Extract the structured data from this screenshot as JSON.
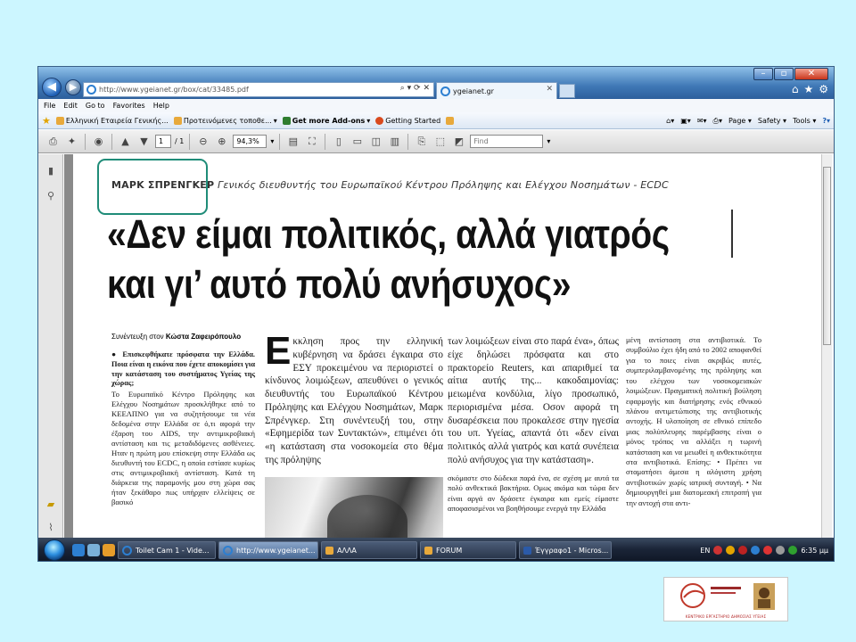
{
  "browser": {
    "address_url": "http://www.ygeianet.gr/box/cat/33485.pdf",
    "tab_title": "ygeianet.gr",
    "menu": [
      "File",
      "Edit",
      "Go to",
      "Favorites",
      "Help"
    ],
    "favorites": [
      {
        "label": "Ελληνική Εταιρεία Γενικής..."
      },
      {
        "label": "Προτεινόμενες τοποθε..."
      },
      {
        "label": "Get more Add-ons"
      },
      {
        "label": "Getting Started"
      }
    ],
    "command_bar": [
      "Page",
      "Safety",
      "Tools"
    ]
  },
  "pdf_toolbar": {
    "page_current": "1",
    "page_total": "/ 1",
    "zoom": "94,3%",
    "find_placeholder": "Find"
  },
  "article": {
    "byline_name": "ΜΑΡΚ ΣΠΡΕΝΓΚΕΡ",
    "byline_role": "Γενικός διευθυντής του Ευρωπαϊκού Κέντρου Πρόληψης και Ελέγχου Νοσημάτων - ECDC",
    "headline_line1": "«Δεν είμαι πολιτικός, αλλά γιατρός",
    "headline_line2": "και γι’ αυτό πολύ ανήσυχος»",
    "credit_prefix": "Συνέντευξη στον",
    "credit_name": "Κώστα Ζαφειρόπουλο",
    "question1": "● Επισκεφθήκατε πρόσφατα την Ελλάδα. Ποια είναι η εικόνα που έχετε αποκομίσει για την κατάσταση του συστήματος Υγείας της χώρας;",
    "answer1": "Το Ευρωπαϊκό Κέντρο Πρόληψης και Ελέγχου Νοσημάτων προσκλήθηκε από το ΚΕΕΛΠΝΟ για να συζητήσουμε τα νέα δεδομένα στην Ελλάδα σε ό,τι αφορά την έξαρση του AIDS, την αντιμικροβιακή αντίσταση και τις μεταδιδόμενες ασθένειες. Ηταν η πρώτη μου επίσκεψη στην Ελλάδα ως διευθυντή του ECDC, η οποία εστίασε κυρίως στις αντιμικροβιακή αντίσταση. Κατά τη διάρκεια της παραμονής μου στη χώρα σας ήταν ξεκάθαρο πως υπήρχαν ελλείψεις σε βασικό",
    "col2_dropcap": "Ε",
    "col2_text": "κκληση προς την ελληνική κυβέρνηση να δράσει έγκαιρα στο ΕΣΥ προκειμένου να περιοριστεί ο κίνδυνος λοιμώξεων, απευθύνει ο γενικός διευθυντής του Ευρωπαϊκού Κέντρου Πρόληψης και Ελέγχου Νοσημάτων, Μαρκ Σπρένγκερ. Στη συνέντευξή του, στην «Εφημερίδα των Συντακτών», επιμένει ότι «η κατάσταση στα νοσοκομεία στο θέμα της πρόληψης",
    "col3_text": "των λοιμώξεων είναι στο παρά ένα», όπως είχε δηλώσει πρόσφατα και στο πρακτορείο Reuters, και απαριθμεί τα αίτια αυτής της... κακοδαιμονίας: μειωμένα κονδύλια, λίγο προσωπικό, περιορισμένα μέσα. Οσον αφορά τη δυσαρέσκεια που προκαλεσε στην ηγεσία του υπ. Υγείας, απαντά ότι «δεν είναι πολιτικός αλλά γιατρός και κατά συνέπεια πολύ ανήσυχος για την κατάσταση».",
    "col3b_text": "σκόμαστε στο δώδεκα παρά ένα, σε σχέση με αυτά τα πολύ ανθεκτικά βακτήρια. Ομως ακόμα και τώρα δεν είναι αργά αν δράσετε έγκαιρα και εμείς είμαστε αποφασισμένοι να βοηθήσουμε ενεργά την Ελλάδα",
    "col4_text": "μένη αντίσταση στα αντιβιοτικά. Το συμβούλιο έχει ήδη από το 2002 αποφανθεί για το ποιες είναι ακριβώς αυτές, συμπεριλαμβανομένης της πρόληψης και του ελέγχου των νοσοκομειακών λοιμώξεων. Πραγματική πολιτική βούληση εφαρμογής και διατήρησης ενός εθνικού πλάνου αντιμετώπισης της αντιβιοτικής αντοχής. Η υλοποίηση σε εθνικό επίπεδο μιας πολύπλευρης παρέμβασης είναι ο μόνος τρόπος να αλλάξει η τωρινή κατάσταση και να μειωθεί η ανθεκτικότητα στα αντιβιοτικά. Επίσης: • Πρέπει να σταματήσει άμεσα η αλόγιστη χρήση αντιβιοτικών χωρίς ιατρική συνταγή. • Να δημιουργηθεί μια διατομεακή επιτροπή για την αντοχή στα αντι-"
  },
  "taskbar": {
    "windows": [
      {
        "label": "Toilet Cam 1 - Vide..."
      },
      {
        "label": "http://www.ygeianet..."
      },
      {
        "label": "ΑΛΛΑ"
      },
      {
        "label": "FORUM"
      },
      {
        "label": "Έγγραφο1 - Micros..."
      }
    ],
    "lang": "EN",
    "clock": "6:35 μμ"
  },
  "logo": {
    "caption": "ΚΕΝΤΡΙΚΟ ΕΡΓΑΣΤΗΡΙΟ ΔΗΜΟΣΙΑΣ ΥΓΕΙΑΣ"
  },
  "colors": {
    "background": "#ccf6ff",
    "annotation": "#1f8c78",
    "title_bar": "#3f78b6"
  }
}
